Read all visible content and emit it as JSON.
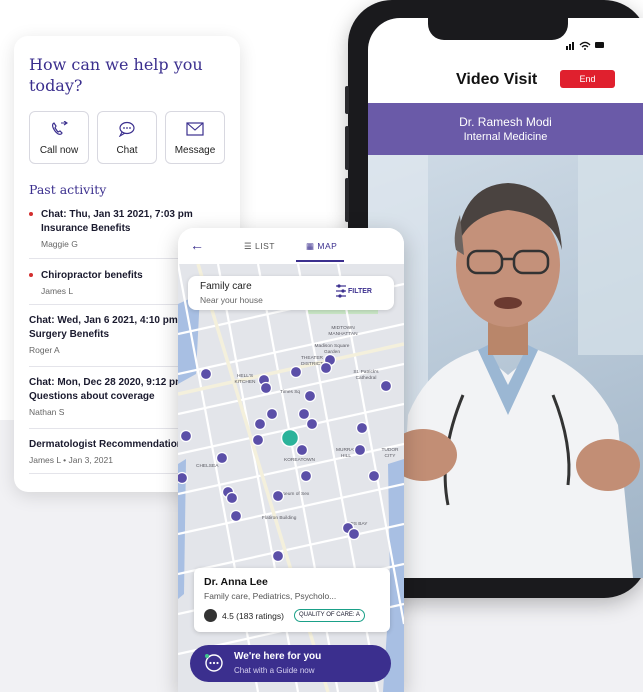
{
  "help": {
    "title": "How can we help you today?",
    "actions": [
      {
        "label": "Call now",
        "icon": "phone-icon"
      },
      {
        "label": "Chat",
        "icon": "chat-bubble-icon"
      },
      {
        "label": "Message",
        "icon": "envelope-icon"
      }
    ],
    "past_activity_title": "Past activity",
    "activities": [
      {
        "title": "Chat: Thu, Jan 31 2021, 7:03 pm",
        "subtitle": "Insurance Benefits",
        "meta": "Maggie G",
        "unread": true
      },
      {
        "title": "Chiropractor benefits",
        "subtitle": "",
        "meta": "James L",
        "unread": true
      },
      {
        "title": "Chat: Wed, Jan 6 2021, 4:10 pm",
        "subtitle": "Surgery Benefits",
        "meta": "Roger A",
        "unread": false
      },
      {
        "title": "Chat: Mon, Dec 28 2020, 9:12 pm",
        "subtitle": "Questions about coverage",
        "meta": "Nathan S",
        "unread": false
      },
      {
        "title": "Dermatologist Recommendation",
        "subtitle": "",
        "meta": "James L • Jan 3, 2021",
        "unread": false
      }
    ]
  },
  "video": {
    "title": "Video Visit",
    "end_label": "End",
    "doctor_name": "Dr. Ramesh Modi",
    "specialty": "Internal Medicine"
  },
  "map": {
    "tab_list": "LIST",
    "tab_map": "MAP",
    "search_title": "Family care",
    "search_sub": "Near your house",
    "filter_label": "FILTER",
    "landmarks": [
      {
        "label": "Carnegie Hall"
      },
      {
        "label": "MIDTOWN MANHATTAN"
      },
      {
        "label": "Madison Square Garden"
      },
      {
        "label": "HELL'S KITCHEN"
      },
      {
        "label": "THEATER DISTRICT"
      },
      {
        "label": "Times Sq"
      },
      {
        "label": "St. Patrick's Cathedral"
      },
      {
        "label": "KOREATOWN"
      },
      {
        "label": "MURRAY HILL"
      },
      {
        "label": "CHELSEA"
      },
      {
        "label": "Museum of Sex"
      },
      {
        "label": "Flatiron Building"
      },
      {
        "label": "KIPS BAY"
      },
      {
        "label": "TUDOR CITY"
      }
    ],
    "card": {
      "name": "Dr. Anna Lee",
      "specialties": "Family care, Pediatrics, Psycholo...",
      "rating": "4.5 (183 ratings)",
      "quality_label": "QUALITY OF CARE: A"
    }
  },
  "chat_bar": {
    "title": "We're here for you",
    "subtitle": "Chat with a Guide now"
  },
  "colors": {
    "brand_purple": "#3b2f8e",
    "video_band": "#6a5aa8",
    "end_red": "#e0202e",
    "map_pin": "#5b4fa8",
    "selected_pin": "#2bb39a"
  }
}
